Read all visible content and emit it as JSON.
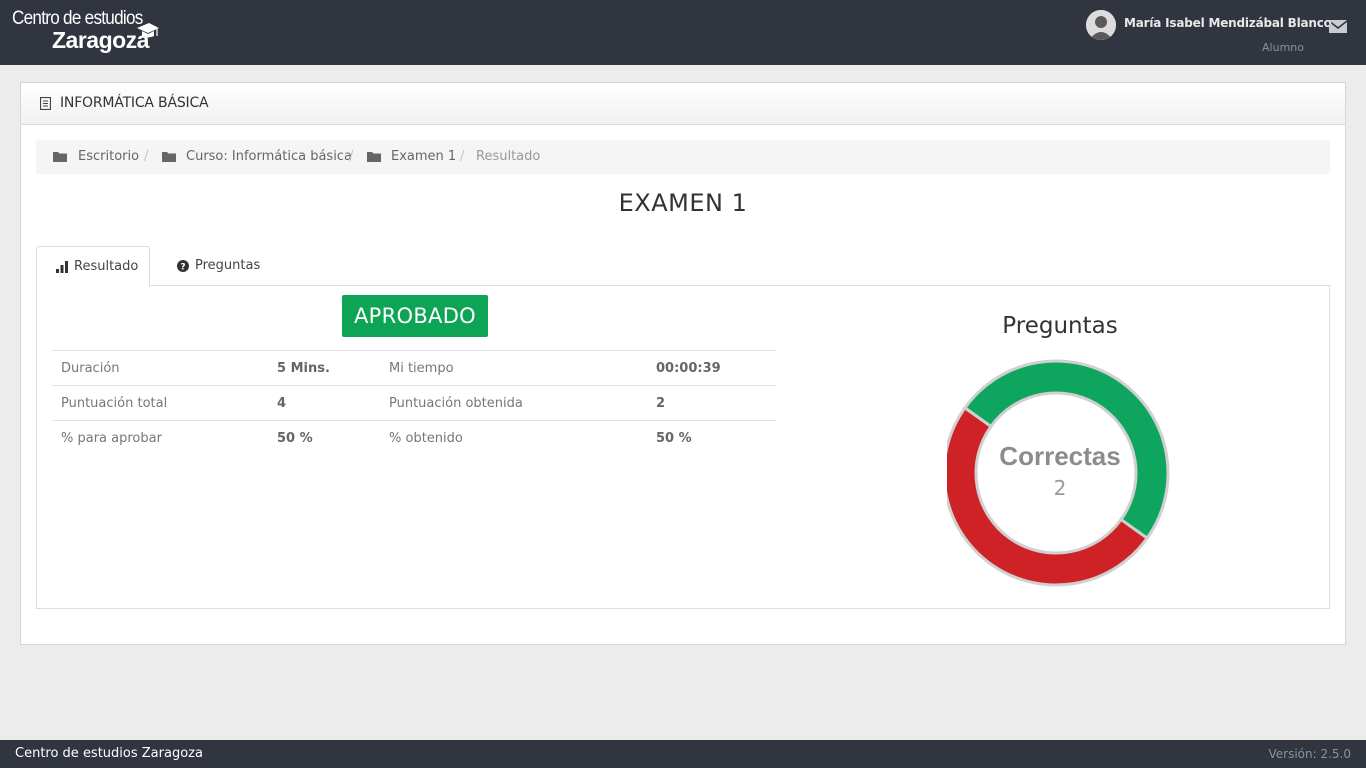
{
  "brand": {
    "line1": "Centro de estudios",
    "line2": "Zaragoza"
  },
  "user": {
    "name": "María Isabel Mendizábal Blanco",
    "role": "Alumno",
    "avatar_icon": "user-avatar-icon",
    "mail_icon": "envelope-icon"
  },
  "panel": {
    "title": "INFORMÁTICA BÁSICA",
    "icon": "document-icon"
  },
  "breadcrumb": {
    "items": [
      {
        "label": "Escritorio",
        "icon": "folder-icon"
      },
      {
        "label": "Curso: Informática básica",
        "icon": "folder-icon"
      },
      {
        "label": "Examen 1",
        "icon": "folder-icon"
      },
      {
        "label": "Resultado"
      }
    ],
    "separator": "/"
  },
  "exam": {
    "title": "EXAMEN 1"
  },
  "tabs": [
    {
      "label": "Resultado",
      "icon": "bar-chart-icon",
      "active": true
    },
    {
      "label": "Preguntas",
      "icon": "question-circle-icon",
      "active": false
    }
  ],
  "result": {
    "status": "APROBADO",
    "status_color": "#0ea455",
    "stats": [
      {
        "label1": "Duración",
        "value1": "5 Mins.",
        "label2": "Mi tiempo",
        "value2": "00:00:39"
      },
      {
        "label1": "Puntuación total",
        "value1": "4",
        "label2": "Puntuación obtenida",
        "value2": "2"
      },
      {
        "label1": "% para aprobar",
        "value1": "50 %",
        "label2": "% obtenido",
        "value2": "50 %"
      }
    ]
  },
  "chart_data": {
    "type": "pie",
    "title": "Preguntas",
    "center_label": "Correctas",
    "center_value": "2",
    "slices": [
      {
        "value": 2,
        "color": "#0ea55f"
      },
      {
        "value": 2,
        "color": "#cf2226"
      }
    ]
  },
  "footer": {
    "left": "Centro de estudios Zaragoza",
    "right": "Versión: 2.5.0"
  }
}
